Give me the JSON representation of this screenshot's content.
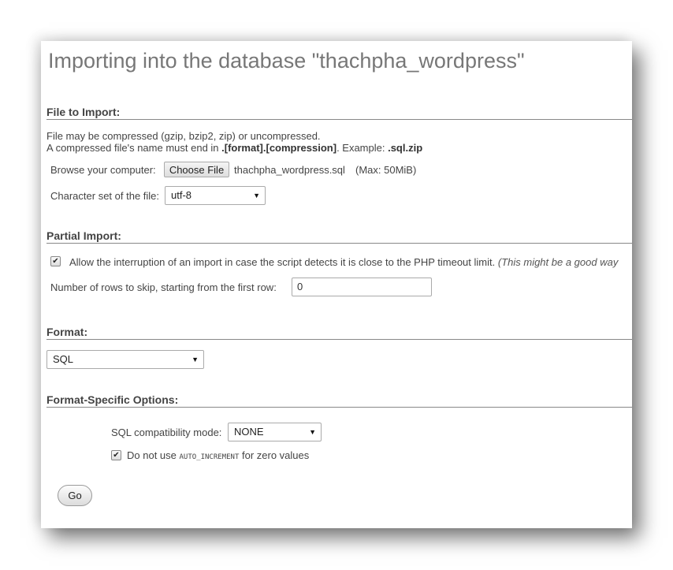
{
  "page": {
    "title": "Importing into the database \"thachpha_wordpress\""
  },
  "file_section": {
    "heading": "File to Import:",
    "line1": "File may be compressed (gzip, bzip2, zip) or uncompressed.",
    "line2_prefix": "A compressed file's name must end in ",
    "line2_bold": ".[format].[compression]",
    "line2_mid": ". Example: ",
    "line2_example": ".sql.zip",
    "browse_label": "Browse your computer:",
    "choose_file_label": "Choose File",
    "file_name": "thachpha_wordpress.sql",
    "max_size": "(Max: 50MiB)",
    "charset_label": "Character set of the file:",
    "charset_value": "utf-8"
  },
  "partial_section": {
    "heading": "Partial Import:",
    "allow_interrupt_checked": true,
    "allow_interrupt_label": "Allow the interruption of an import in case the script detects it is close to the PHP timeout limit.",
    "allow_interrupt_note": "(This might be a good way",
    "skip_rows_label": "Number of rows to skip, starting from the first row:",
    "skip_rows_value": "0"
  },
  "format_section": {
    "heading": "Format:",
    "format_value": "SQL"
  },
  "options_section": {
    "heading": "Format-Specific Options:",
    "compat_label": "SQL compatibility mode:",
    "compat_value": "NONE",
    "no_auto_inc_checked": true,
    "no_auto_inc_prefix": "Do not use ",
    "no_auto_inc_code": "AUTO_INCREMENT",
    "no_auto_inc_suffix": " for zero values"
  },
  "actions": {
    "go_label": "Go"
  },
  "icons": {
    "dropdown": "▼",
    "check": "✔"
  }
}
